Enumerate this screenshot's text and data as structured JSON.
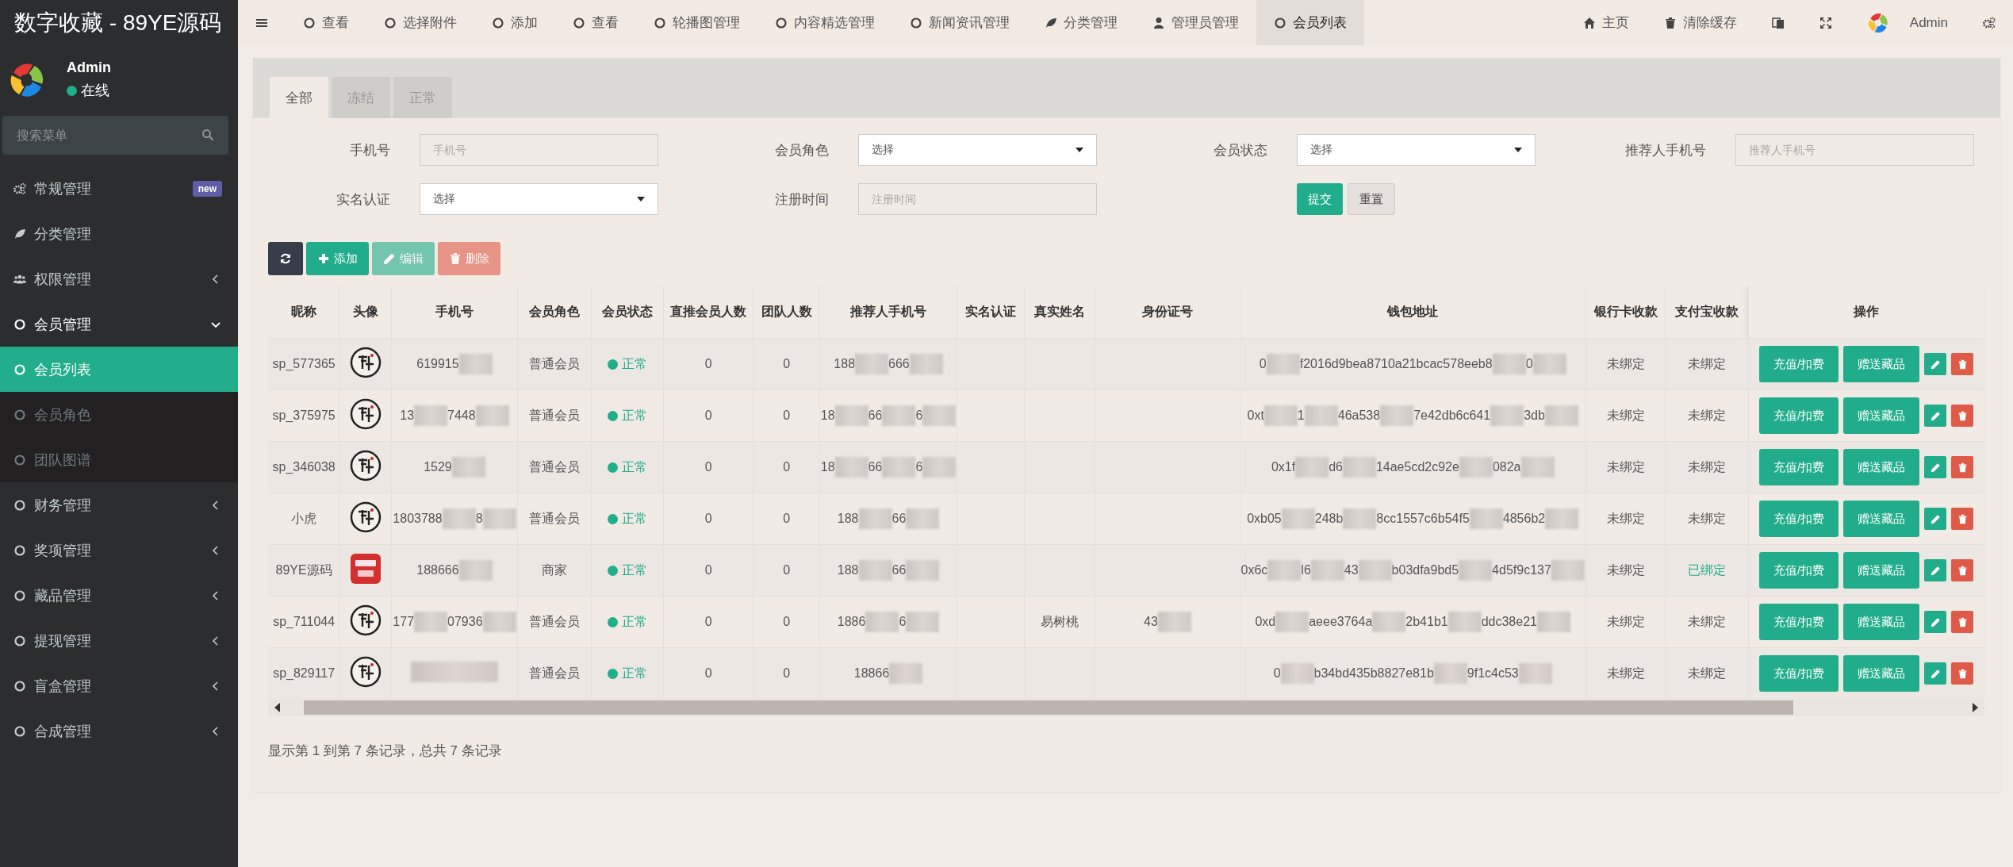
{
  "app_title": "数字收藏 - 89YE源码",
  "top_nav": [
    {
      "kind": "circle",
      "label": "查看",
      "selected": false
    },
    {
      "kind": "circle",
      "label": "选择附件",
      "selected": false
    },
    {
      "kind": "circle",
      "label": "添加",
      "selected": false
    },
    {
      "kind": "circle",
      "label": "查看",
      "selected": false
    },
    {
      "kind": "circle",
      "label": "轮播图管理",
      "selected": false
    },
    {
      "kind": "circle",
      "label": "内容精选管理",
      "selected": false
    },
    {
      "kind": "circle",
      "label": "新闻资讯管理",
      "selected": false
    },
    {
      "kind": "leaf",
      "label": "分类管理",
      "selected": false
    },
    {
      "kind": "user",
      "label": "管理员管理",
      "selected": false
    },
    {
      "kind": "circle",
      "label": "会员列表",
      "selected": true
    }
  ],
  "top_right": {
    "home": "主页",
    "clear_cache": "清除缓存",
    "user": "Admin"
  },
  "sidebar": {
    "user": {
      "name": "Admin",
      "status": "在线"
    },
    "search": {
      "placeholder": "搜索菜单"
    },
    "items": [
      {
        "kind": "gears",
        "label": "常规管理",
        "badge": "new",
        "selected": false
      },
      {
        "kind": "leaf",
        "label": "分类管理",
        "selected": false
      },
      {
        "kind": "users",
        "label": "权限管理",
        "expanded": false,
        "selected": false
      },
      {
        "kind": "circle",
        "label": "会员管理",
        "expanded": true,
        "selected": false,
        "children": [
          {
            "label": "会员列表",
            "selected": true
          },
          {
            "label": "会员角色",
            "selected": false
          },
          {
            "label": "团队图谱",
            "selected": false
          }
        ]
      },
      {
        "kind": "circle",
        "label": "财务管理",
        "expanded": false,
        "selected": false
      },
      {
        "kind": "circle",
        "label": "奖项管理",
        "expanded": false,
        "selected": false
      },
      {
        "kind": "circle",
        "label": "藏品管理",
        "expanded": false,
        "selected": false
      },
      {
        "kind": "circle",
        "label": "提现管理",
        "expanded": false,
        "selected": false
      },
      {
        "kind": "circle",
        "label": "盲盒管理",
        "expanded": false,
        "selected": false
      },
      {
        "kind": "circle",
        "label": "合成管理",
        "expanded": false,
        "selected": false
      }
    ]
  },
  "tabs": [
    {
      "label": "全部",
      "selected": true
    },
    {
      "label": "冻结",
      "selected": false
    },
    {
      "label": "正常",
      "selected": false
    }
  ],
  "filters": [
    {
      "label": "手机号",
      "kind": "input",
      "placeholder": "手机号"
    },
    {
      "label": "会员角色",
      "kind": "select",
      "value": "选择"
    },
    {
      "label": "会员状态",
      "kind": "select",
      "value": "选择"
    },
    {
      "label": "推荐人手机号",
      "kind": "input",
      "placeholder": "推荐人手机号"
    },
    {
      "label": "实名认证",
      "kind": "select",
      "value": "选择"
    },
    {
      "label": "注册时间",
      "kind": "input",
      "placeholder": "注册时间"
    }
  ],
  "filter_buttons": [
    "提交",
    "重置"
  ],
  "toolbar": [
    {
      "kind": "refresh",
      "disabled": false
    },
    {
      "kind": "add",
      "label": "添加",
      "disabled": false
    },
    {
      "kind": "edit",
      "label": "编辑",
      "disabled": true
    },
    {
      "kind": "delete",
      "label": "删除",
      "disabled": true
    }
  ],
  "table": {
    "columns": [
      "昵称",
      "头像",
      "手机号",
      "会员角色",
      "会员状态",
      "直推会员人数",
      "团队人数",
      "推荐人手机号",
      "实名认证",
      "真实姓名",
      "身份证号",
      "钱包地址",
      "银行卡收款",
      "支付宝收款",
      "操作"
    ],
    "rows": [
      {
        "nickname": "sp_577365",
        "avatar": {
          "kind": "seal"
        },
        "actions": [
          "充值/扣费",
          "赠送藏品"
        ],
        "phone": {
          "parts": [
            "619915"
          ],
          "redacted": true
        },
        "role": "普通会员",
        "status": "正常",
        "direct": "0",
        "team": "0",
        "referrer": {
          "parts": [
            "188",
            "666"
          ],
          "redacted": true
        },
        "wallet": {
          "parts": [
            "0",
            "f2016d9bea8710a21bcac578eeb8",
            "0"
          ],
          "redacted": true
        },
        "bank": "未绑定",
        "alipay": "未绑定",
        "alipay_bound": false
      },
      {
        "nickname": "sp_375975",
        "avatar": {
          "kind": "seal"
        },
        "actions": [
          "充值/扣费",
          "赠送藏品"
        ],
        "phone": {
          "parts": [
            "13",
            "7448"
          ],
          "redacted": true
        },
        "role": "普通会员",
        "status": "正常",
        "direct": "0",
        "team": "0",
        "referrer": {
          "parts": [
            "18",
            "66",
            "6"
          ],
          "redacted": true
        },
        "wallet": {
          "parts": [
            "0xt",
            "1",
            "46a538",
            "7e42db6c641",
            "3db"
          ],
          "redacted": true
        },
        "bank": "未绑定",
        "alipay": "未绑定",
        "alipay_bound": false
      },
      {
        "nickname": "sp_346038",
        "avatar": {
          "kind": "seal"
        },
        "actions": [
          "充值/扣费",
          "赠送藏品"
        ],
        "phone": {
          "parts": [
            "1529"
          ],
          "redacted": true
        },
        "role": "普通会员",
        "status": "正常",
        "direct": "0",
        "team": "0",
        "referrer": {
          "parts": [
            "18",
            "66",
            "6"
          ],
          "redacted": true
        },
        "wallet": {
          "parts": [
            "0x1f",
            "d6",
            "14ae5cd2c92e",
            "082a"
          ],
          "redacted": true
        },
        "bank": "未绑定",
        "alipay": "未绑定",
        "alipay_bound": false
      },
      {
        "nickname": "小虎",
        "avatar": {
          "kind": "seal"
        },
        "actions": [
          "充值/扣费",
          "赠送藏品"
        ],
        "phone": {
          "parts": [
            "1803788",
            "8"
          ],
          "redacted": true
        },
        "role": "普通会员",
        "status": "正常",
        "direct": "0",
        "team": "0",
        "referrer": {
          "parts": [
            "188",
            "66"
          ],
          "redacted": true
        },
        "wallet": {
          "parts": [
            "0xb05",
            "248b",
            "8cc1557c6b54f5",
            "4856b2"
          ],
          "redacted": true
        },
        "bank": "未绑定",
        "alipay": "未绑定",
        "alipay_bound": false
      },
      {
        "nickname": "89YE源码",
        "avatar": {
          "kind": "logo"
        },
        "actions": [
          "充值/扣费",
          "赠送藏品"
        ],
        "phone": {
          "parts": [
            "188666"
          ],
          "redacted": true
        },
        "role": "商家",
        "status": "正常",
        "direct": "0",
        "team": "0",
        "referrer": {
          "parts": [
            "188",
            "66"
          ],
          "redacted": true
        },
        "wallet": {
          "parts": [
            "0x6c",
            "l6",
            "43",
            "b03dfa9bd5",
            "4d5f9c137"
          ],
          "redacted": true
        },
        "bank": "未绑定",
        "alipay": "已绑定",
        "alipay_bound": true
      },
      {
        "nickname": "sp_711044",
        "avatar": {
          "kind": "seal"
        },
        "actions": [
          "充值/扣费",
          "赠送藏品"
        ],
        "phone": {
          "parts": [
            "177",
            "07936"
          ],
          "redacted": true
        },
        "role": "普通会员",
        "status": "正常",
        "direct": "0",
        "team": "0",
        "referrer": {
          "parts": [
            "1886",
            "6"
          ],
          "redacted": true
        },
        "real_name": "易树桃",
        "id_number": {
          "parts": [
            "43"
          ],
          "redacted": true
        },
        "wallet": {
          "parts": [
            "0xd",
            "aeee3764a",
            "2b41b1",
            "ddc38e21"
          ],
          "redacted": true
        },
        "bank": "未绑定",
        "alipay": "未绑定",
        "alipay_bound": false
      },
      {
        "nickname": "sp_829117",
        "avatar": {
          "kind": "seal"
        },
        "actions": [
          "充值/扣费",
          "赠送藏品"
        ],
        "phone": {
          "redacted": true
        },
        "role": "普通会员",
        "status": "正常",
        "direct": "0",
        "team": "0",
        "referrer": {
          "parts": [
            "18866"
          ],
          "redacted": true
        },
        "wallet": {
          "parts": [
            "0",
            "b34bd435b8827e81b",
            "9f1c4c53"
          ],
          "redacted": true
        },
        "bank": "未绑定",
        "alipay": "未绑定",
        "alipay_bound": false
      }
    ]
  },
  "pagination_info": "显示第 1 到第 7 条记录，总共 7 条记录"
}
